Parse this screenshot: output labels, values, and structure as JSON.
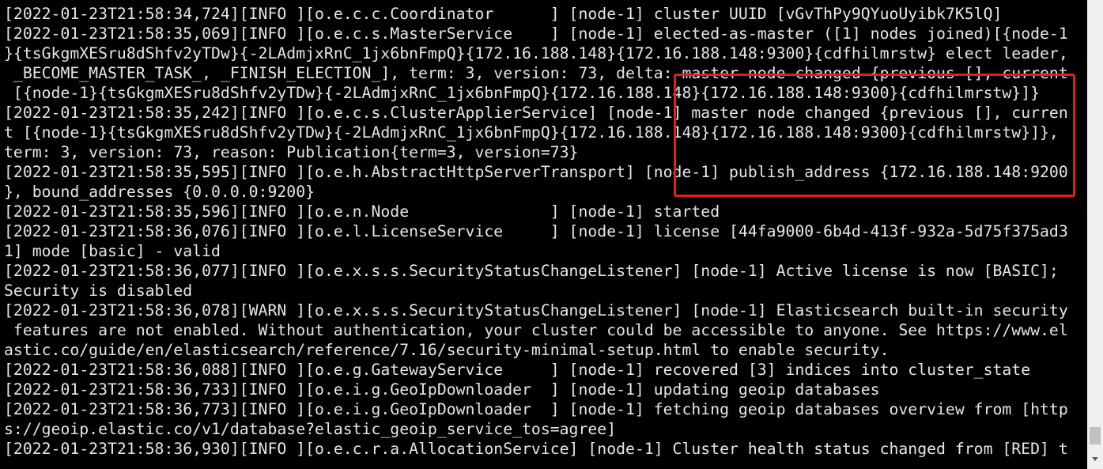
{
  "terminal": {
    "lines": [
      "[2022-01-23T21:58:34,724][INFO ][o.e.c.c.Coordinator      ] [node-1] cluster UUID [vGvThPy9QYuoUyibk7K5lQ]",
      "[2022-01-23T21:58:35,069][INFO ][o.e.c.s.MasterService    ] [node-1] elected-as-master ([1] nodes joined)[{node-1",
      "}{tsGkgmXESru8dShfv2yTDw}{-2LAdmjxRnC_1jx6bnFmpQ}{172.16.188.148}{172.16.188.148:9300}{cdfhilmrstw} elect leader,",
      " _BECOME_MASTER_TASK_, _FINISH_ELECTION_], term: 3, version: 73, delta: master node changed {previous [], current",
      " [{node-1}{tsGkgmXESru8dShfv2yTDw}{-2LAdmjxRnC_1jx6bnFmpQ}{172.16.188.148}{172.16.188.148:9300}{cdfhilmrstw}]}",
      "[2022-01-23T21:58:35,242][INFO ][o.e.c.s.ClusterApplierService] [node-1] master node changed {previous [], curren",
      "t [{node-1}{tsGkgmXESru8dShfv2yTDw}{-2LAdmjxRnC_1jx6bnFmpQ}{172.16.188.148}{172.16.188.148:9300}{cdfhilmrstw}]},",
      "term: 3, version: 73, reason: Publication{term=3, version=73}",
      "[2022-01-23T21:58:35,595][INFO ][o.e.h.AbstractHttpServerTransport] [node-1] publish_address {172.16.188.148:9200",
      "}, bound_addresses {0.0.0.0:9200}",
      "[2022-01-23T21:58:35,596][INFO ][o.e.n.Node               ] [node-1] started",
      "[2022-01-23T21:58:36,076][INFO ][o.e.l.LicenseService     ] [node-1] license [44fa9000-6b4d-413f-932a-5d75f375ad3",
      "1] mode [basic] - valid",
      "[2022-01-23T21:58:36,077][INFO ][o.e.x.s.s.SecurityStatusChangeListener] [node-1] Active license is now [BASIC];",
      "Security is disabled",
      "[2022-01-23T21:58:36,078][WARN ][o.e.x.s.s.SecurityStatusChangeListener] [node-1] Elasticsearch built-in security",
      " features are not enabled. Without authentication, your cluster could be accessible to anyone. See https://www.el",
      "astic.co/guide/en/elasticsearch/reference/7.16/security-minimal-setup.html to enable security.",
      "[2022-01-23T21:58:36,088][INFO ][o.e.g.GatewayService     ] [node-1] recovered [3] indices into cluster_state",
      "[2022-01-23T21:58:36,733][INFO ][o.e.i.g.GeoIpDownloader  ] [node-1] updating geoip databases",
      "[2022-01-23T21:58:36,773][INFO ][o.e.i.g.GeoIpDownloader  ] [node-1] fetching geoip databases overview from [http",
      "s://geoip.elastic.co/v1/database?elastic_geoip_service_tos=agree]",
      "[2022-01-23T21:58:36,930][INFO ][o.e.c.r.a.AllocationService] [node-1] Cluster health status changed from [RED] t"
    ]
  },
  "colors": {
    "background": "#000000",
    "text": "#e6e6e6",
    "highlight": "#e02020"
  }
}
